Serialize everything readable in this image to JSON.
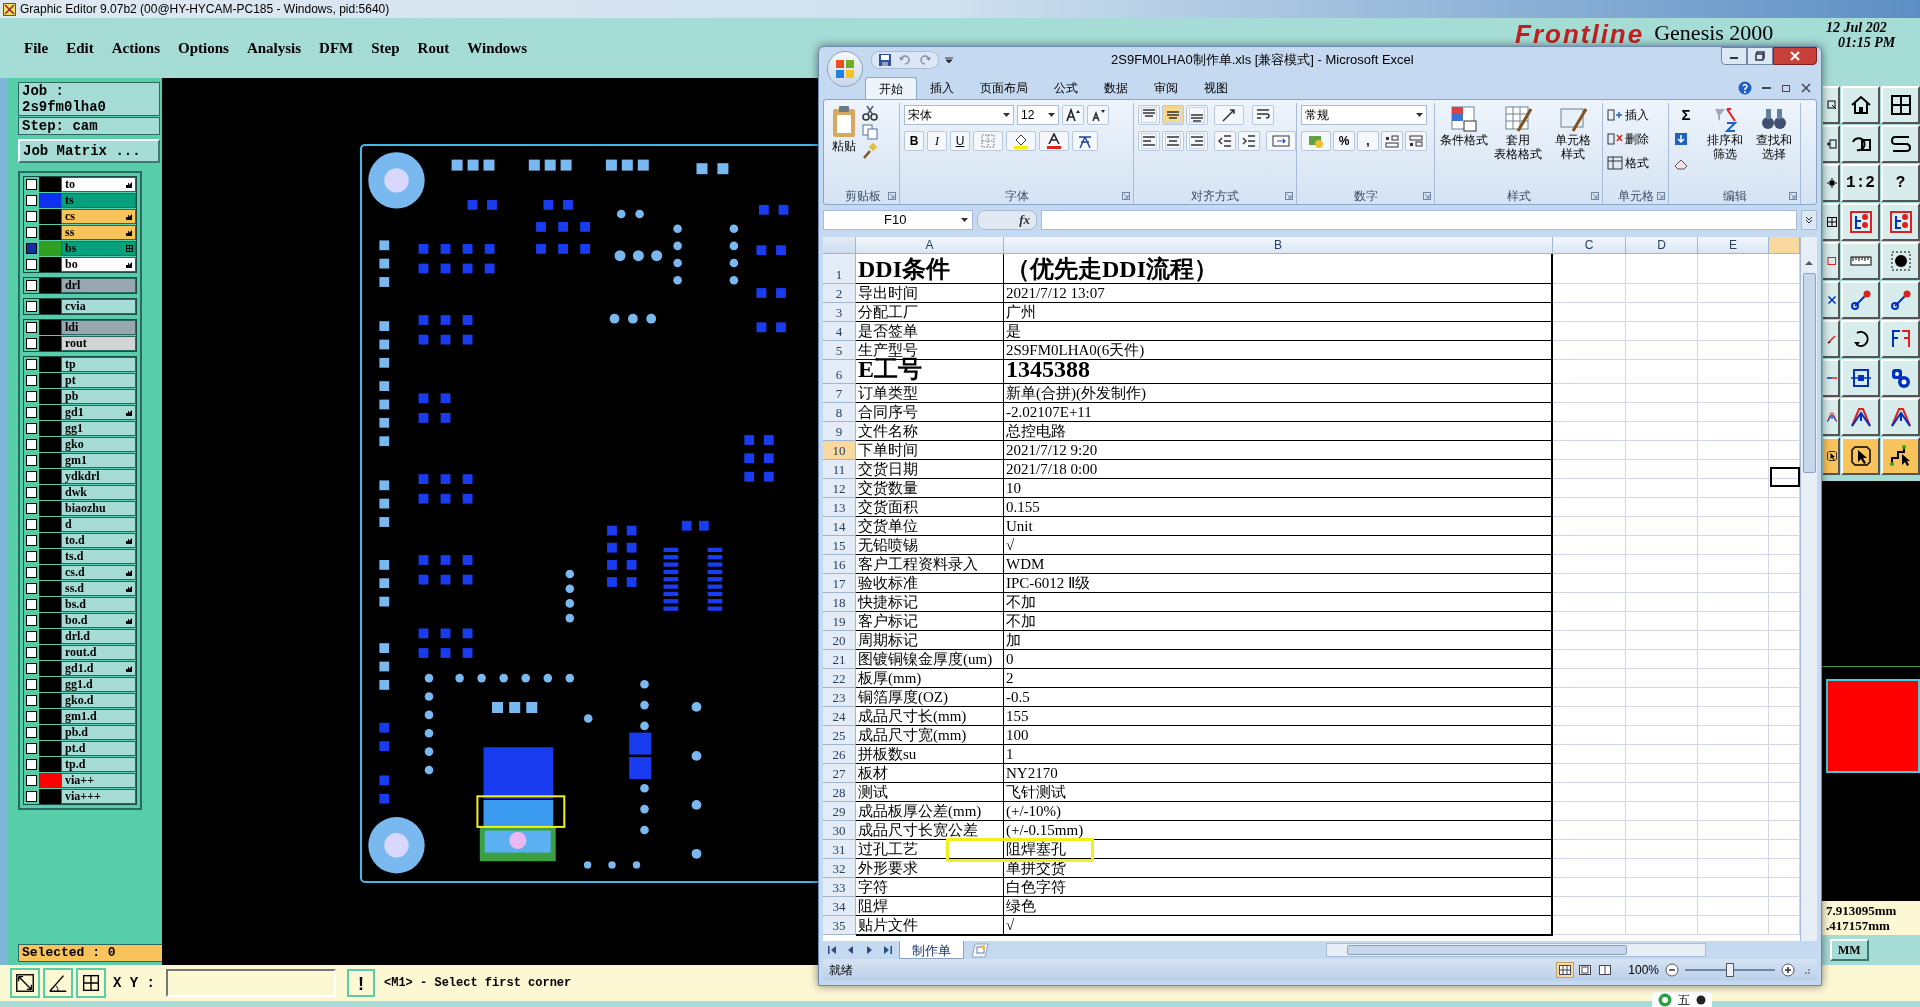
{
  "genesis": {
    "title": "Graphic Editor 9.07b2 (00@HY-HYCAM-PC185 - Windows, pid:5640)",
    "menu": [
      "File",
      "Edit",
      "Actions",
      "Options",
      "Analysis",
      "DFM",
      "Step",
      "Rout",
      "Windows"
    ],
    "brand": {
      "logo": "Frontline",
      "product": "Genesis 2000",
      "date": "12 Jul 202",
      "time": "01:15 PM"
    },
    "job": "Job : 2s9fm0lha0",
    "step": "Step: cam",
    "job_matrix_button": "Job Matrix ...",
    "layer_groups": [
      [
        {
          "name": "to",
          "color": "#000000",
          "kind": "silk",
          "checked": false,
          "hand": true
        },
        {
          "name": "ts",
          "color": "#1030f0",
          "kind": "mask",
          "checked": false
        },
        {
          "name": "cs",
          "color": "#000000",
          "kind": "paste",
          "checked": false,
          "hand": true
        },
        {
          "name": "ss",
          "color": "#000000",
          "kind": "paste",
          "checked": false,
          "hand": true
        },
        {
          "name": "bs",
          "color": "#30a020",
          "kind": "mask",
          "checked": true,
          "grid": true
        },
        {
          "name": "bo",
          "color": "#000000",
          "kind": "silk",
          "checked": false,
          "hand": true
        }
      ],
      [
        {
          "name": "drl",
          "color": "#000000",
          "kind": "drill",
          "checked": false
        }
      ],
      [
        {
          "name": "cvia",
          "color": "#000000",
          "kind": "misc",
          "checked": false
        }
      ],
      [
        {
          "name": "ldi",
          "color": "#000000",
          "kind": "drill",
          "checked": false
        },
        {
          "name": "rout",
          "color": "#000000",
          "kind": "rout",
          "checked": false
        }
      ],
      [
        {
          "name": "tp",
          "color": "#000000",
          "kind": "misc",
          "checked": false
        },
        {
          "name": "pt",
          "color": "#000000",
          "kind": "misc",
          "checked": false
        },
        {
          "name": "pb",
          "color": "#000000",
          "kind": "misc",
          "checked": false
        },
        {
          "name": "gd1",
          "color": "#000000",
          "kind": "misc",
          "checked": false,
          "hand": true
        },
        {
          "name": "gg1",
          "color": "#000000",
          "kind": "misc",
          "checked": false
        },
        {
          "name": "gko",
          "color": "#000000",
          "kind": "misc",
          "checked": false
        },
        {
          "name": "gm1",
          "color": "#000000",
          "kind": "misc",
          "checked": false
        },
        {
          "name": "ydkdrl",
          "color": "#000000",
          "kind": "misc",
          "checked": false
        },
        {
          "name": "dwk",
          "color": "#000000",
          "kind": "misc",
          "checked": false
        },
        {
          "name": "biaozhu",
          "color": "#000000",
          "kind": "misc",
          "checked": false
        },
        {
          "name": "d",
          "color": "#000000",
          "kind": "misc",
          "checked": false
        },
        {
          "name": "to.d",
          "color": "#000000",
          "kind": "misc",
          "checked": false,
          "hand": true
        },
        {
          "name": "ts.d",
          "color": "#000000",
          "kind": "misc",
          "checked": false
        },
        {
          "name": "cs.d",
          "color": "#000000",
          "kind": "misc",
          "checked": false,
          "hand": true
        },
        {
          "name": "ss.d",
          "color": "#000000",
          "kind": "misc",
          "checked": false,
          "hand": true
        },
        {
          "name": "bs.d",
          "color": "#000000",
          "kind": "misc",
          "checked": false
        },
        {
          "name": "bo.d",
          "color": "#000000",
          "kind": "misc",
          "checked": false,
          "hand": true
        },
        {
          "name": "drl.d",
          "color": "#000000",
          "kind": "misc",
          "checked": false
        },
        {
          "name": "rout.d",
          "color": "#000000",
          "kind": "misc",
          "checked": false
        },
        {
          "name": "gd1.d",
          "color": "#000000",
          "kind": "misc",
          "checked": false,
          "hand": true
        },
        {
          "name": "gg1.d",
          "color": "#000000",
          "kind": "misc",
          "checked": false
        },
        {
          "name": "gko.d",
          "color": "#000000",
          "kind": "misc",
          "checked": false
        },
        {
          "name": "gm1.d",
          "color": "#000000",
          "kind": "misc",
          "checked": false
        },
        {
          "name": "pb.d",
          "color": "#000000",
          "kind": "misc",
          "checked": false
        },
        {
          "name": "pt.d",
          "color": "#000000",
          "kind": "misc",
          "checked": false
        },
        {
          "name": "tp.d",
          "color": "#000000",
          "kind": "misc",
          "checked": false
        },
        {
          "name": "via++",
          "color": "#ff0000",
          "kind": "misc",
          "checked": false
        },
        {
          "name": "via+++",
          "color": "#000000",
          "kind": "misc",
          "checked": false
        }
      ]
    ],
    "selected_count": "Selected : 0",
    "xy_label": "X Y :",
    "alert_button": "!",
    "prompt": "<M1> - Select first corner",
    "tool_buttons": [
      {
        "kind": "window"
      },
      {
        "kind": "house"
      },
      {
        "kind": "grid"
      },
      {
        "kind": "panel"
      },
      {
        "kind": "undo"
      },
      {
        "kind": "scurve"
      },
      {
        "kind": "move"
      },
      {
        "kind": "text",
        "label": "1:2"
      },
      {
        "kind": "text",
        "label": "?"
      },
      {
        "kind": "grid"
      },
      {
        "kind": "net"
      },
      {
        "kind": "net"
      },
      {
        "kind": "square"
      },
      {
        "kind": "ruler"
      },
      {
        "kind": "dot"
      },
      {
        "kind": "cross"
      },
      {
        "kind": "connect"
      },
      {
        "kind": "connect"
      },
      {
        "kind": "pen"
      },
      {
        "kind": "rotate"
      },
      {
        "kind": "mirror"
      },
      {
        "kind": "line"
      },
      {
        "kind": "snap"
      },
      {
        "kind": "circles"
      },
      {
        "kind": "trace"
      },
      {
        "kind": "trace"
      },
      {
        "kind": "trace"
      },
      {
        "kind": "pointer"
      },
      {
        "kind": "pointer"
      },
      {
        "kind": "steps"
      }
    ],
    "coordinates": [
      "7.913095mm",
      ".417157mm"
    ],
    "units": "MM",
    "ime": "五"
  },
  "excel": {
    "title": "2S9FM0LHA0制作单.xls  [兼容模式] - Microsoft Excel",
    "tabs": [
      {
        "label": "开始",
        "selected": true
      },
      {
        "label": "插入",
        "selected": false
      },
      {
        "label": "页面布局",
        "selected": false
      },
      {
        "label": "公式",
        "selected": false
      },
      {
        "label": "数据",
        "selected": false
      },
      {
        "label": "审阅",
        "selected": false
      },
      {
        "label": "视图",
        "selected": false
      }
    ],
    "ribbon_groups": [
      {
        "kind": "clipboard",
        "label": "剪贴板",
        "buttons": [
          "粘贴"
        ]
      },
      {
        "kind": "font",
        "label": "字体",
        "font": "宋体",
        "size": "12",
        "buttons": [
          "B",
          "I",
          "U"
        ]
      },
      {
        "kind": "alignment",
        "label": "对齐方式"
      },
      {
        "kind": "number",
        "label": "数字",
        "format": "常规",
        "buttons": [
          "%",
          ","
        ]
      },
      {
        "kind": "styles",
        "label": "样式",
        "buttons": [
          [
            "条件格式"
          ],
          [
            "套用",
            "表格格式"
          ],
          [
            "单元格",
            "样式"
          ]
        ]
      },
      {
        "kind": "cells",
        "label": "单元格",
        "buttons": [
          "插入",
          "删除",
          "格式"
        ]
      },
      {
        "kind": "editing",
        "label": "编辑",
        "sum": "Σ",
        "buttons": [
          [
            "排序和",
            "筛选"
          ],
          [
            "查找和",
            "选择"
          ]
        ]
      }
    ],
    "name_box": "F10",
    "fx": "fx",
    "columns": [
      {
        "label": "A",
        "selected": false
      },
      {
        "label": "B",
        "selected": false
      },
      {
        "label": "C",
        "selected": false
      },
      {
        "label": "D",
        "selected": false
      },
      {
        "label": "E",
        "selected": false
      },
      {
        "selected": true
      }
    ],
    "rows": [
      {
        "number": "1",
        "label": "DDI条件",
        "value": "（优先走DDI流程）",
        "kind": "title",
        "selected": false
      },
      {
        "number": "2",
        "label": "导出时间",
        "value": "2021/7/12 13:07",
        "kind": "normal",
        "selected": false
      },
      {
        "number": "3",
        "label": "分配工厂",
        "value": "广州",
        "kind": "normal",
        "selected": false
      },
      {
        "number": "4",
        "label": "是否签单",
        "value": "是",
        "kind": "normal",
        "selected": false
      },
      {
        "number": "5",
        "label": "生产型号",
        "value": "2S9FM0LHA0(6天件)",
        "kind": "normal",
        "selected": false
      },
      {
        "number": "6",
        "label": "E工号",
        "value": "1345388",
        "kind": "title",
        "selected": false
      },
      {
        "number": "7",
        "label": "订单类型",
        "value": "新单(合拼)(外发制作)",
        "kind": "normal",
        "selected": false
      },
      {
        "number": "8",
        "label": "合同序号",
        "value": "-2.02107E+11",
        "kind": "normal",
        "selected": false
      },
      {
        "number": "9",
        "label": "文件名称",
        "value": "总控电路",
        "kind": "normal",
        "selected": false
      },
      {
        "number": "10",
        "label": "下单时间",
        "value": "2021/7/12 9:20",
        "kind": "normal",
        "selected": true
      },
      {
        "number": "11",
        "label": "交货日期",
        "value": "2021/7/18 0:00",
        "kind": "normal",
        "selected": false
      },
      {
        "number": "12",
        "label": "交货数量",
        "value": "10",
        "kind": "normal",
        "selected": false
      },
      {
        "number": "13",
        "label": "交货面积",
        "value": "0.155",
        "kind": "normal",
        "selected": false
      },
      {
        "number": "14",
        "label": "交货单位",
        "value": "Unit",
        "kind": "normal",
        "selected": false
      },
      {
        "number": "15",
        "label": "无铅喷锡",
        "value": "√",
        "kind": "normal",
        "selected": false
      },
      {
        "number": "16",
        "label": "客户工程资料录入",
        "value": "WDM",
        "kind": "normal",
        "selected": false
      },
      {
        "number": "17",
        "label": "验收标准",
        "value": "IPC-6012 Ⅱ级",
        "kind": "normal",
        "selected": false
      },
      {
        "number": "18",
        "label": "快捷标记",
        "value": "不加",
        "kind": "normal",
        "selected": false
      },
      {
        "number": "19",
        "label": "客户标记",
        "value": "不加",
        "kind": "normal",
        "selected": false
      },
      {
        "number": "20",
        "label": "周期标记",
        "value": "加",
        "kind": "normal",
        "selected": false
      },
      {
        "number": "21",
        "label": "图镀铜镍金厚度(um)",
        "value": "0",
        "kind": "normal",
        "selected": false
      },
      {
        "number": "22",
        "label": "板厚(mm)",
        "value": "2",
        "kind": "normal",
        "selected": false
      },
      {
        "number": "23",
        "label": "铜箔厚度(OZ)",
        "value": "-0.5",
        "kind": "normal",
        "selected": false
      },
      {
        "number": "24",
        "label": "成品尺寸长(mm)",
        "value": "155",
        "kind": "normal",
        "selected": false
      },
      {
        "number": "25",
        "label": "成品尺寸宽(mm)",
        "value": "100",
        "kind": "normal",
        "selected": false
      },
      {
        "number": "26",
        "label": "拼板数su",
        "value": "1",
        "kind": "normal",
        "selected": false
      },
      {
        "number": "27",
        "label": "板材",
        "value": "NY2170",
        "kind": "normal",
        "selected": false
      },
      {
        "number": "28",
        "label": "测试",
        "value": "飞针测试",
        "kind": "normal",
        "selected": false
      },
      {
        "number": "29",
        "label": "成品板厚公差(mm)",
        "value": "(+/-10%)",
        "kind": "normal",
        "selected": false
      },
      {
        "number": "30",
        "label": "成品尺寸长宽公差",
        "value": "(+/-0.15mm)",
        "kind": "normal",
        "selected": false
      },
      {
        "number": "31",
        "label": "过孔工艺",
        "value": "阻焊塞孔",
        "kind": "normal",
        "selected": false
      },
      {
        "number": "32",
        "label": "外形要求",
        "value": "单拼交货",
        "kind": "normal",
        "selected": false
      },
      {
        "number": "33",
        "label": "字符",
        "value": "白色字符",
        "kind": "normal",
        "selected": false
      },
      {
        "number": "34",
        "label": "阻焊",
        "value": "绿色",
        "kind": "normal",
        "selected": false
      },
      {
        "number": "35",
        "label": "贴片文件",
        "value": "√",
        "kind": "normal",
        "selected": false
      }
    ],
    "sheet_tab": "制作单",
    "status": "就绪",
    "zoom": "100%",
    "zoom_slider": {
      "level": 0.5
    }
  }
}
